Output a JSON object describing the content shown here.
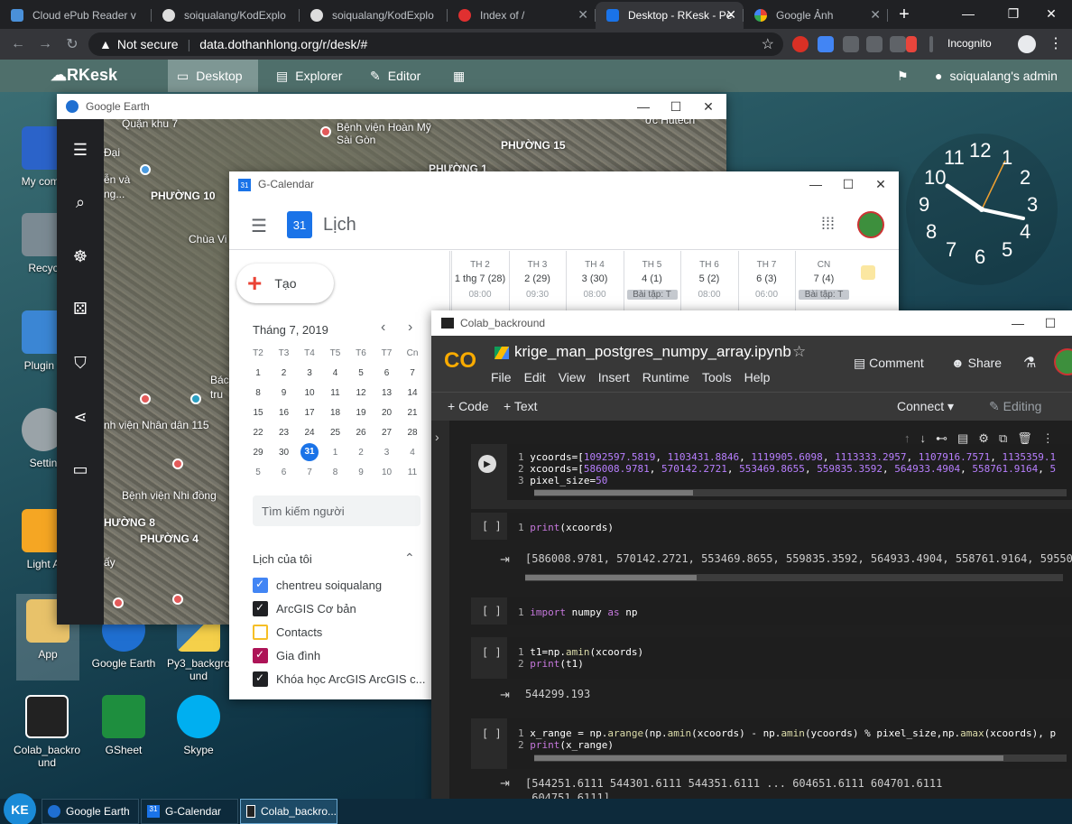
{
  "browser": {
    "tabs": [
      {
        "title": "Cloud ePub Reader v",
        "color": "#4a90d9"
      },
      {
        "title": "soiqualang/KodExplo",
        "color": "#ddd"
      },
      {
        "title": "soiqualang/KodExplo",
        "color": "#ddd"
      },
      {
        "title": "Index of /",
        "color": "#e03030"
      },
      {
        "title": "Desktop - RKesk - Pe",
        "color": "#1a73e8"
      },
      {
        "title": "Google Ảnh",
        "color": "#fbbc04"
      }
    ],
    "new_tab": "+",
    "window_controls": {
      "min": "—",
      "max": "❐",
      "close": "✕"
    },
    "not_secure": "Not secure",
    "url": "data.dothanhlong.org/r/desk/#",
    "incognito": "Incognito"
  },
  "app": {
    "logo": "RKesk",
    "menu": [
      {
        "label": "Desktop",
        "icon": "desktop-icon"
      },
      {
        "label": "Explorer",
        "icon": "explorer-icon"
      },
      {
        "label": "Editor",
        "icon": "editor-icon"
      }
    ],
    "user": "soiqualang's admin"
  },
  "desktop_icons": [
    {
      "label": "My comp",
      "color": "#2b63c9"
    },
    {
      "label": "Recyc",
      "color": "#7b8a93"
    },
    {
      "label": "Plugin c",
      "color": "#3b86d4"
    },
    {
      "label": "Settin",
      "color": "#9aa3a8"
    },
    {
      "label": "Light A",
      "color": "#f5a623"
    },
    {
      "label": "App",
      "color": "#e8c26a"
    },
    {
      "label": "Google Earth",
      "color": "#1f6fd1"
    },
    {
      "label": "Py3_backgro und",
      "color": "#f5d04a"
    },
    {
      "label": "Colab_backro und",
      "color": "#222"
    },
    {
      "label": "GSheet",
      "color": "#1e8e3e"
    },
    {
      "label": "Skype",
      "color": "#00aff0"
    }
  ],
  "clock": {
    "numbers": [
      "12",
      "1",
      "2",
      "3",
      "4",
      "5",
      "6",
      "7",
      "8",
      "9",
      "10",
      "11"
    ]
  },
  "taskbar": {
    "start": "KE",
    "items": [
      "Google Earth",
      "G-Calendar",
      "Colab_backro..."
    ]
  },
  "earth": {
    "title": "Google Earth",
    "labels": [
      "Quận khu 7",
      "Bệnh viện Hoàn Mỹ Sài Gòn",
      "PHƯỜNG 15",
      "PHƯỜNG 1",
      "Đại",
      "ễn và",
      "ng...",
      "PHƯỜNG 10",
      "Chùa Vi",
      "Bác",
      "tru",
      "nh viện Nhân dân 115",
      "Bệnh viện Nhi đồng",
      "HƯỜNG 8",
      "PHƯỜNG 4",
      "ấy",
      "ớc Hutech"
    ]
  },
  "calendar": {
    "title": "G-Calendar",
    "app_name": "Lịch",
    "logo_num": "31",
    "create": "Tạo",
    "month": "Tháng 7, 2019",
    "weekdays": [
      "T2",
      "T3",
      "T4",
      "T5",
      "T6",
      "T7",
      "Cn"
    ],
    "weeks": [
      [
        "1",
        "2",
        "3",
        "4",
        "5",
        "6",
        "7"
      ],
      [
        "8",
        "9",
        "10",
        "11",
        "12",
        "13",
        "14"
      ],
      [
        "15",
        "16",
        "17",
        "18",
        "19",
        "20",
        "21"
      ],
      [
        "22",
        "23",
        "24",
        "25",
        "26",
        "27",
        "28"
      ],
      [
        "29",
        "30",
        "31",
        "1",
        "2",
        "3",
        "4"
      ],
      [
        "5",
        "6",
        "7",
        "8",
        "9",
        "10",
        "11"
      ]
    ],
    "search_people": "Tìm kiếm người",
    "my_calendars": "Lịch của tôi",
    "calendars": [
      {
        "name": "chentreu soiqualang",
        "color": "#4285f4",
        "checked": true
      },
      {
        "name": "ArcGIS Cơ bản",
        "color": "#202124",
        "checked": true
      },
      {
        "name": "Contacts",
        "color": "#f6bf26",
        "checked": false
      },
      {
        "name": "Gia đình",
        "color": "#ad1457",
        "checked": true
      },
      {
        "name": "Khóa học ArcGIS ArcGIS c...",
        "color": "#202124",
        "checked": true
      }
    ],
    "week_days": [
      {
        "dow": "TH 2",
        "date": "1 thg 7",
        "count": "(28)",
        "time": "08:00"
      },
      {
        "dow": "TH 3",
        "date": "2",
        "count": "(29)",
        "time": "09:30"
      },
      {
        "dow": "TH 4",
        "date": "3",
        "count": "(30)",
        "time": "08:00"
      },
      {
        "dow": "TH 5",
        "date": "4",
        "count": "(1)",
        "time": "Bài tập: T"
      },
      {
        "dow": "TH 6",
        "date": "5",
        "count": "(2)",
        "time": "08:00"
      },
      {
        "dow": "TH 7",
        "date": "6",
        "count": "(3)",
        "time": "06:00"
      },
      {
        "dow": "CN",
        "date": "7",
        "count": "(4)",
        "time": "Bài tập: T"
      }
    ]
  },
  "colab": {
    "title": "Colab_backround",
    "notebook": "krige_man_postgres_numpy_array.ipynb",
    "menu": [
      "File",
      "Edit",
      "View",
      "Insert",
      "Runtime",
      "Tools",
      "Help"
    ],
    "comment": "Comment",
    "share": "Share",
    "add_code": "+ Code",
    "add_text": "+ Text",
    "connect": "Connect",
    "editing": "Editing",
    "cells": [
      {
        "bracket": "",
        "lines": [
          "ycoords=[1092597.5819, 1103431.8846, 1119905.6098, 1113333.2957, 1107916.7571, 1135359.1",
          "xcoords=[586008.9781, 570142.2721, 553469.8655, 559835.3592, 564933.4904, 558761.9164, 5",
          "pixel_size=50"
        ],
        "output": ""
      },
      {
        "bracket": "[ ]",
        "lines": [
          "print(xcoords)"
        ],
        "output": "[586008.9781, 570142.2721, 553469.8655, 559835.3592, 564933.4904, 558761.9164, 595502.6"
      },
      {
        "bracket": "[ ]",
        "lines": [
          "import numpy as np"
        ],
        "output": ""
      },
      {
        "bracket": "[ ]",
        "lines": [
          "t1=np.amin(xcoords)",
          "print(t1)"
        ],
        "output": "544299.193"
      },
      {
        "bracket": "[ ]",
        "lines": [
          "x_range = np.arange(np.amin(xcoords) - np.amin(ycoords) % pixel_size,np.amax(xcoords), p",
          "print(x_range)"
        ],
        "output": "[544251.6111 544301.6111 544351.6111 ... 604651.6111 604701.6111\n 604751.6111]"
      }
    ]
  }
}
